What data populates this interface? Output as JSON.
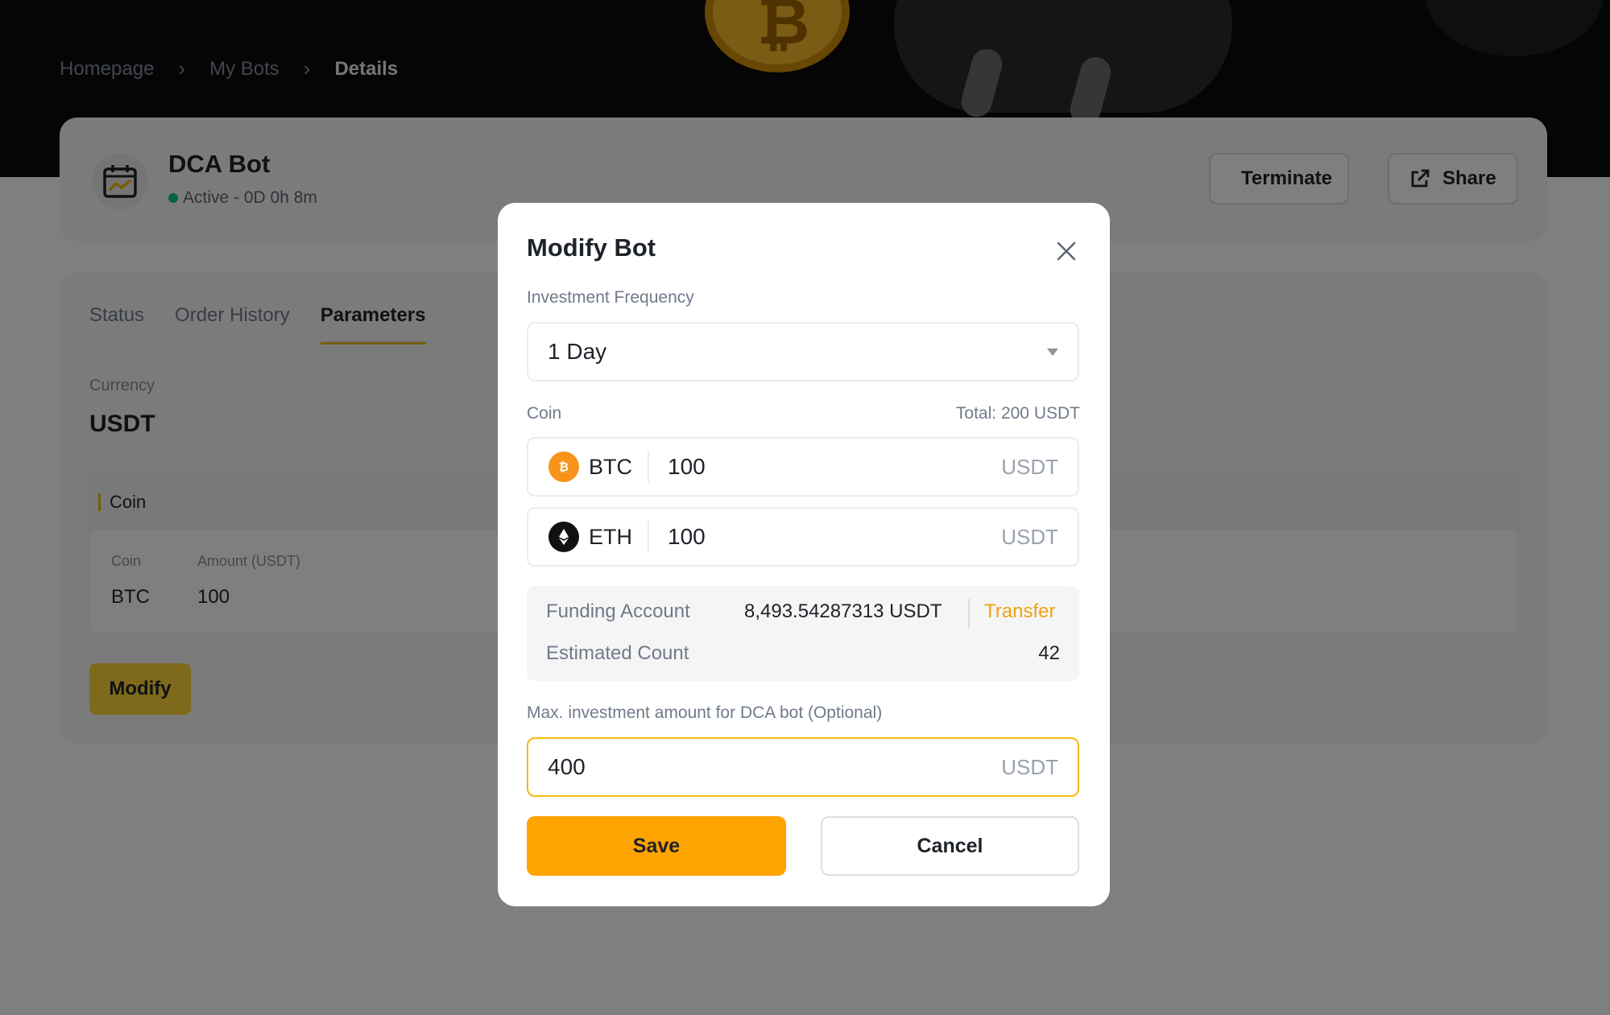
{
  "breadcrumb": {
    "items": [
      "Homepage",
      "My Bots"
    ],
    "current": "Details",
    "separator": "›"
  },
  "bot": {
    "title": "DCA Bot",
    "status": "Active - 0D 0h 8m",
    "status_color": "#0ecb81"
  },
  "header_actions": {
    "terminate": "Terminate",
    "share": "Share"
  },
  "tabs": [
    {
      "label": "Status",
      "active": false
    },
    {
      "label": "Order History",
      "active": false
    },
    {
      "label": "Parameters",
      "active": true
    }
  ],
  "parameters": {
    "currency_label": "Currency",
    "currency_value": "USDT",
    "coin_section_title": "Coin",
    "columns": [
      "Coin",
      "Amount (USDT)"
    ],
    "rows": [
      {
        "coin": "BTC",
        "amount": "100"
      }
    ],
    "modify_label": "Modify"
  },
  "modal": {
    "title": "Modify Bot",
    "frequency_label": "Investment Frequency",
    "frequency_value": "1 Day",
    "coin_label": "Coin",
    "total_label": "Total: 200 USDT",
    "coins": [
      {
        "symbol": "BTC",
        "amount": "100",
        "unit": "USDT",
        "icon": "bitcoin-icon",
        "color": "#f7931a"
      },
      {
        "symbol": "ETH",
        "amount": "100",
        "unit": "USDT",
        "icon": "ethereum-icon",
        "color": "#111111"
      }
    ],
    "funding_label": "Funding Account",
    "funding_value": "8,493.54287313 USDT",
    "transfer_label": "Transfer",
    "estimated_label": "Estimated Count",
    "estimated_value": "42",
    "max_label": "Max. investment amount for DCA bot (Optional)",
    "max_value": "400",
    "max_unit": "USDT",
    "save_label": "Save",
    "cancel_label": "Cancel"
  },
  "colors": {
    "accent": "#f0b90b",
    "save_button": "#ffa300",
    "transfer_link": "#f0a30f"
  }
}
